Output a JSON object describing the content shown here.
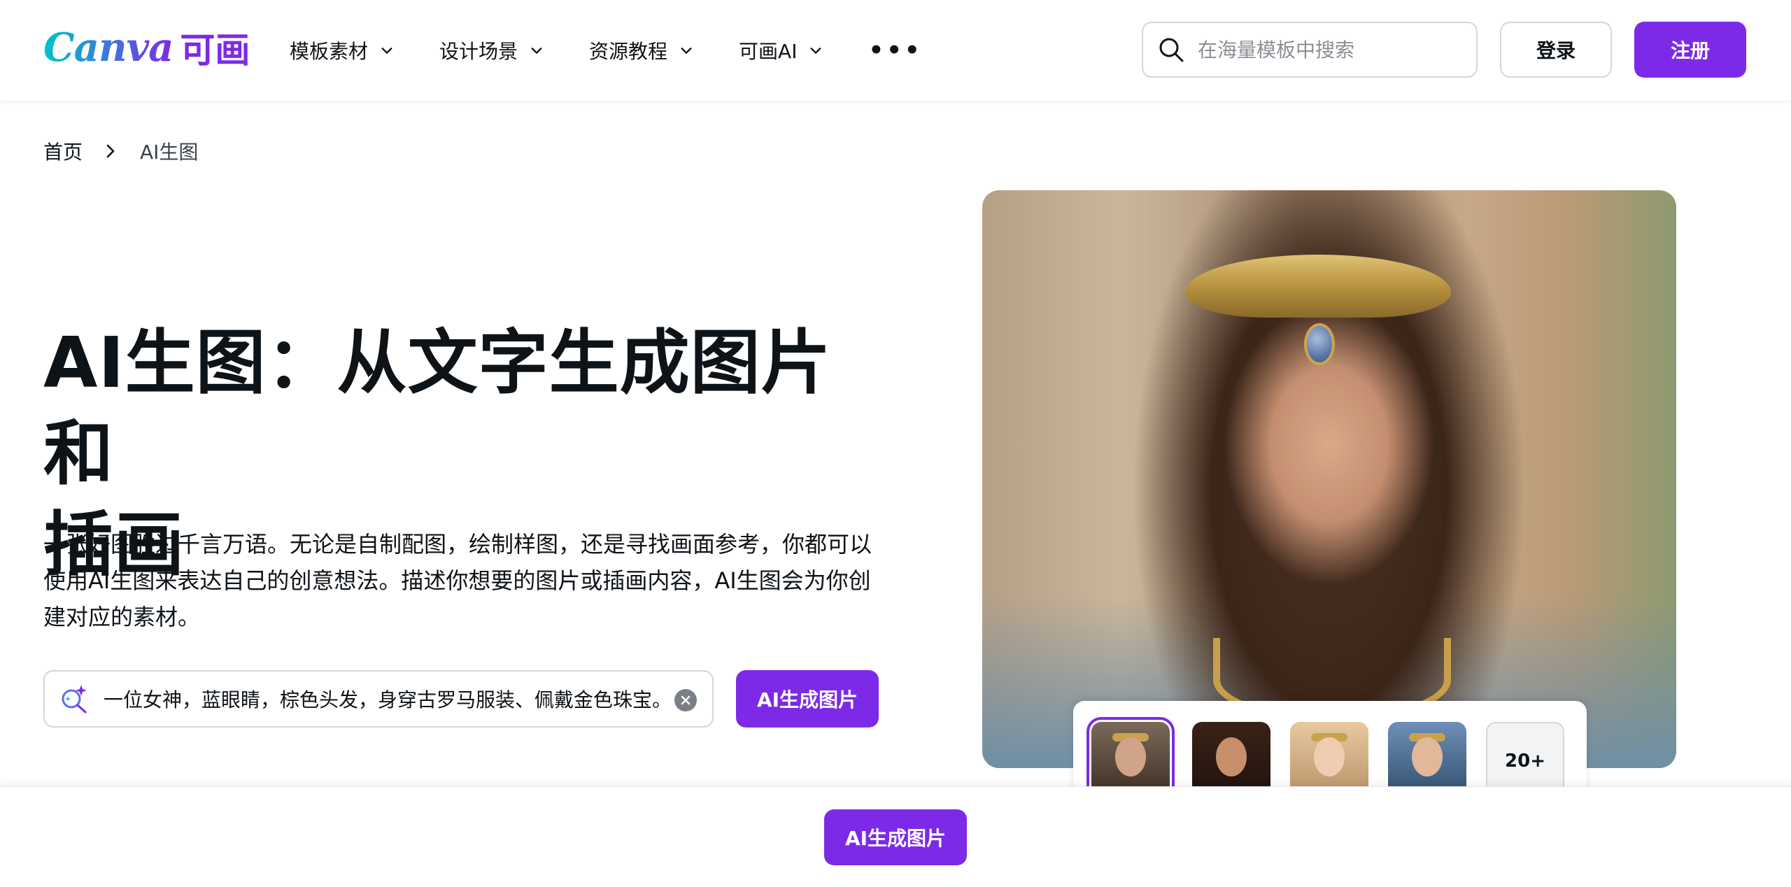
{
  "header": {
    "logo_text": "Canva",
    "logo_cn": "可画",
    "nav": [
      {
        "label": "模板素材",
        "icon": "chevron-down-icon"
      },
      {
        "label": "设计场景",
        "icon": "chevron-down-icon"
      },
      {
        "label": "资源教程",
        "icon": "chevron-down-icon"
      },
      {
        "label": "可画AI",
        "icon": "chevron-down-icon"
      }
    ],
    "more_label": "•••",
    "search_placeholder": "在海量模板中搜索",
    "login_label": "登录",
    "register_label": "注册"
  },
  "breadcrumb": {
    "home": "首页",
    "current": "AI生图"
  },
  "hero": {
    "title_line1": "AI生图：从文字生成图片和",
    "title_line2": "插画",
    "description_line1": "一张好图胜过千言万语。无论是自制配图，绘制样图，还是寻找画面参考，你都可以",
    "description_line2": "使用AI生图来表达自己的创意想法。描述你想要的图片或插画内容，AI生图会为你创",
    "description_line3": "建对应的素材。",
    "prompt_value": "一位女神，蓝眼睛，棕色头发，身穿古罗马服装、佩戴金色珠宝。",
    "generate_label": "AI生成图片"
  },
  "gallery": {
    "more_label": "20+",
    "selected_index": 0
  },
  "bottom_bar": {
    "generate_label": "AI生成图片"
  },
  "colors": {
    "brand_purple": "#7d2ae8",
    "brand_teal": "#00c4cc",
    "text": "#0e1318",
    "border": "#d4d6d9"
  }
}
